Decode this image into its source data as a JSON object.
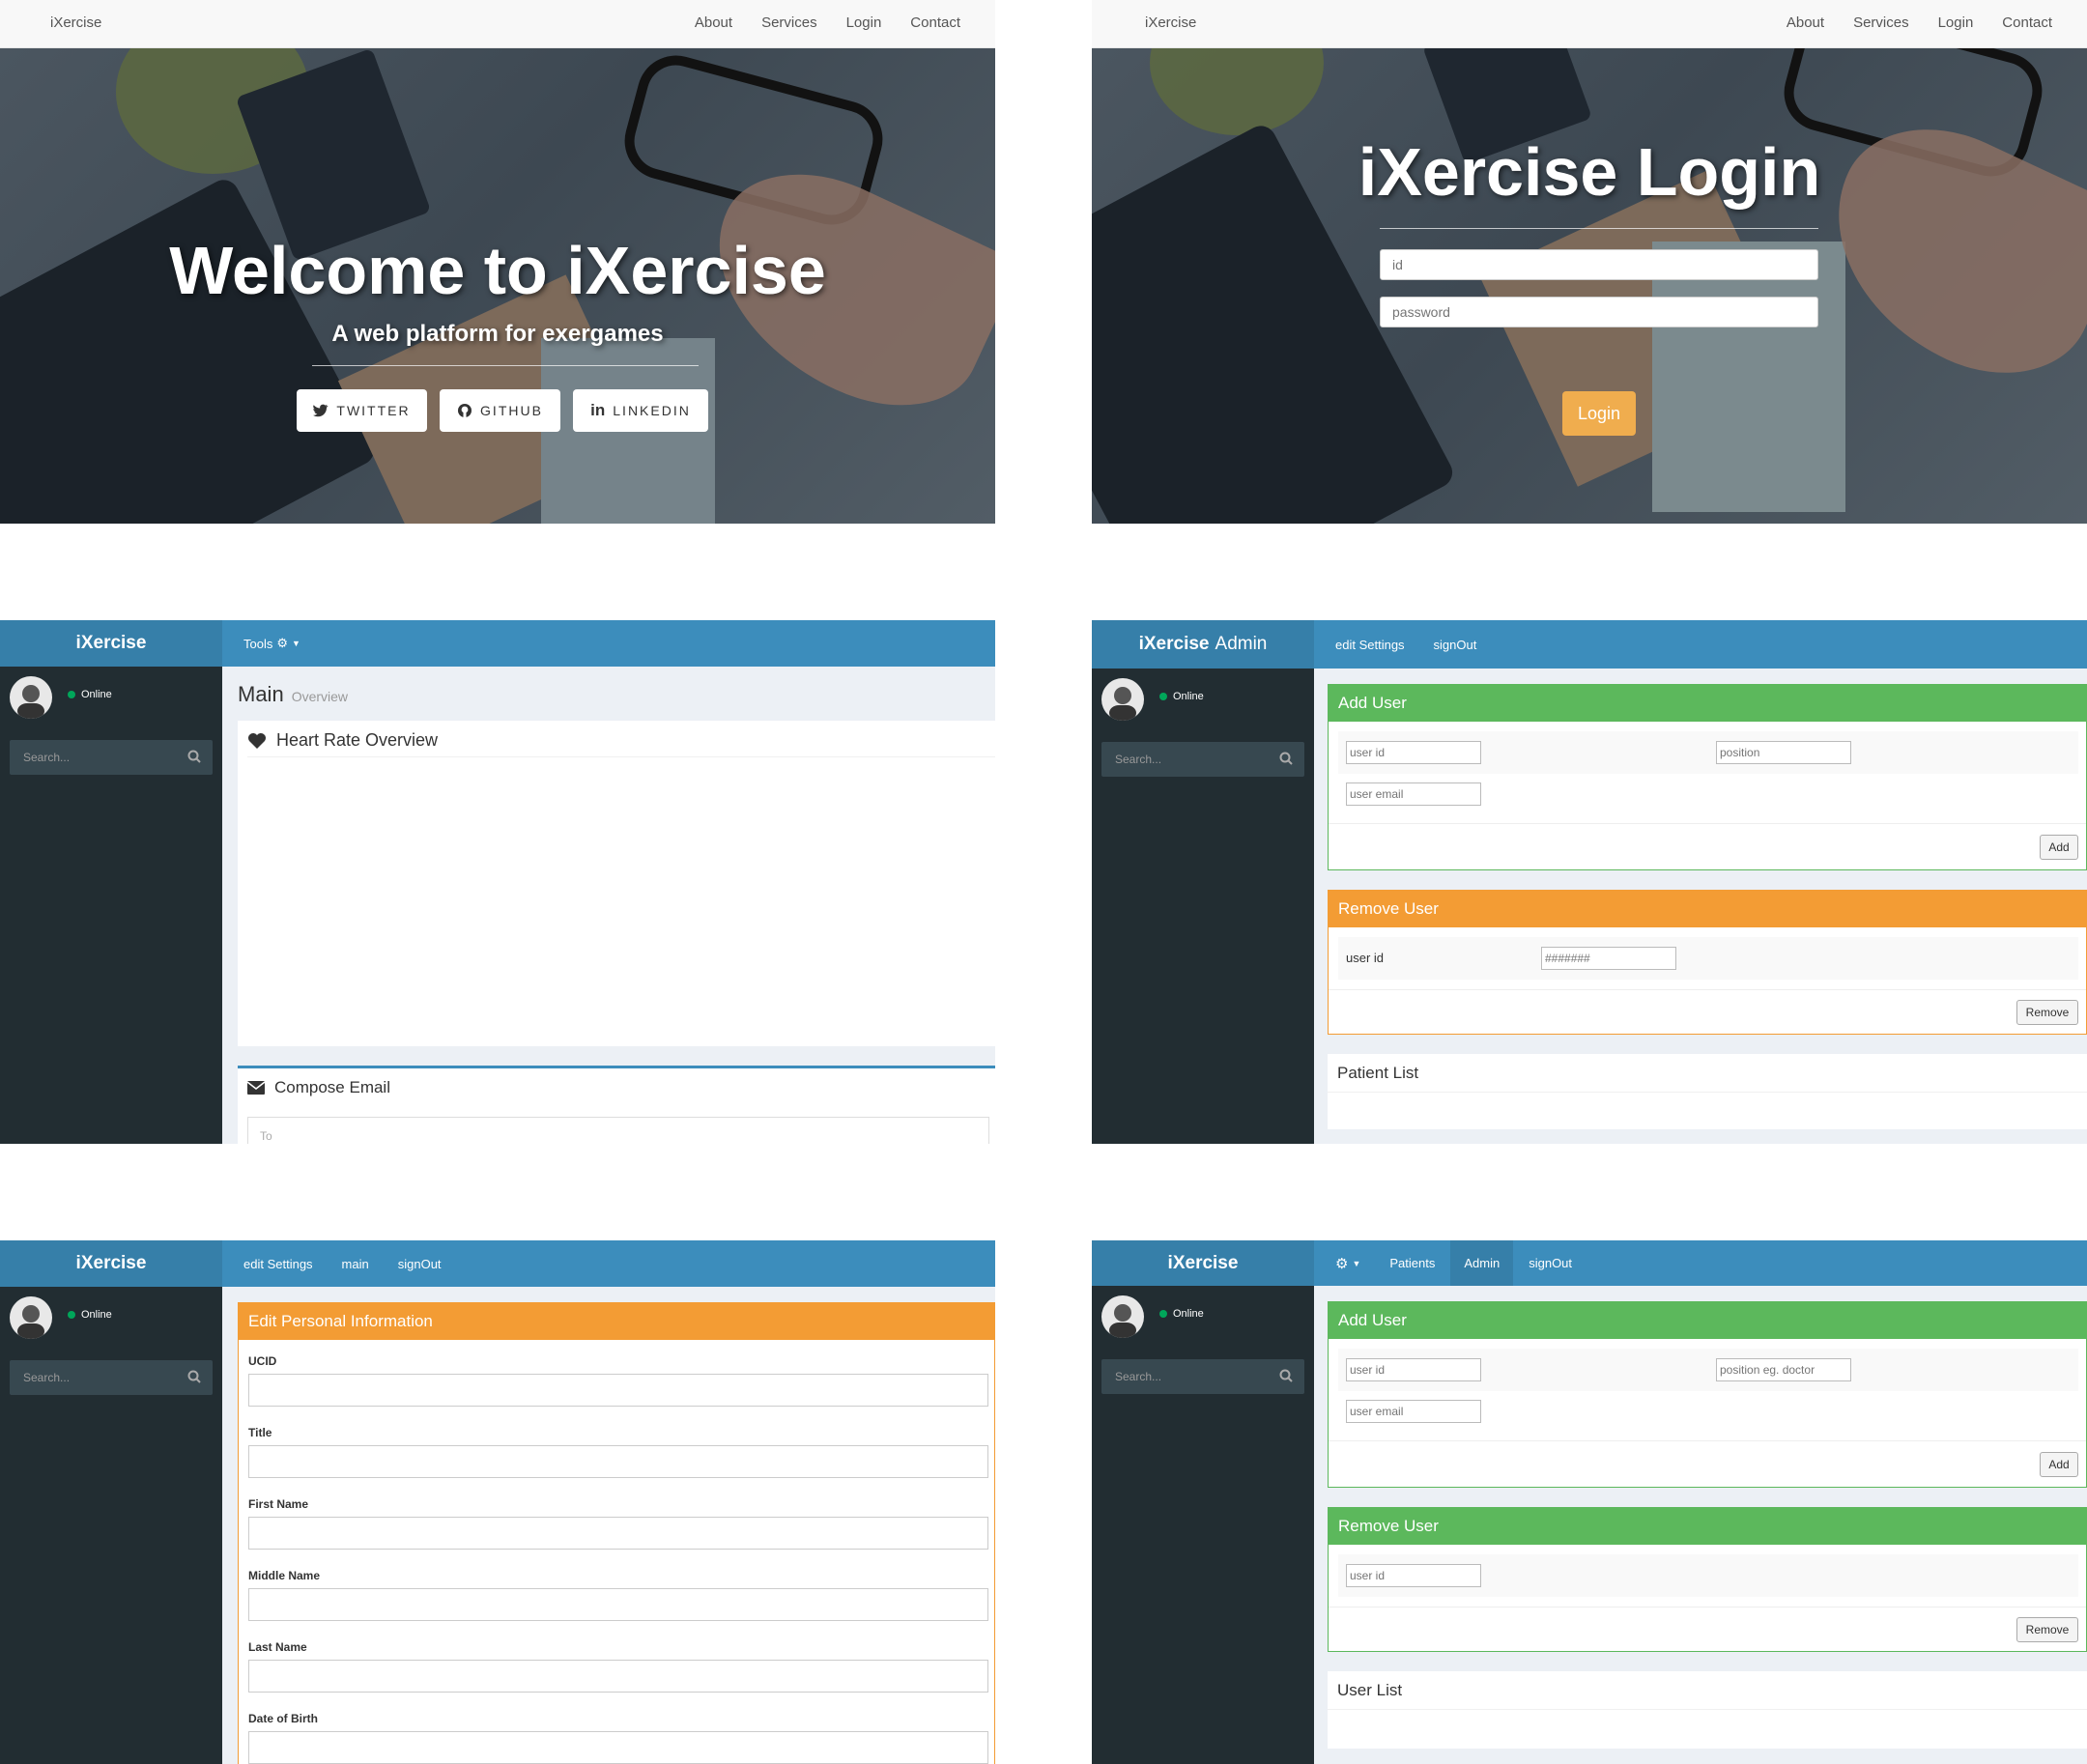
{
  "landing": {
    "brand": "iXercise",
    "nav": [
      "About",
      "Services",
      "Login",
      "Contact"
    ],
    "title": "Welcome to iXercise",
    "subtitle": "A web platform for exergames",
    "buttons": [
      {
        "label": "TWITTER",
        "icon": "twitter-icon"
      },
      {
        "label": "GITHUB",
        "icon": "github-icon"
      },
      {
        "label": "LINKEDIN",
        "icon": "linkedin-icon"
      }
    ]
  },
  "login": {
    "brand": "iXercise",
    "nav": [
      "About",
      "Services",
      "Login",
      "Contact"
    ],
    "title": "iXercise Login",
    "id_placeholder": "id",
    "password_placeholder": "password",
    "login_label": "Login"
  },
  "main": {
    "logo": "iXercise",
    "tools_label": "Tools",
    "online": "Online",
    "search_placeholder": "Search...",
    "page_title": "Main",
    "page_subtitle": "Overview",
    "heart_box_title": "Heart Rate Overview",
    "compose_title": "Compose Email",
    "to_placeholder": "To"
  },
  "admin": {
    "logo_bold": "iXercise",
    "logo_light": "Admin",
    "nav": [
      "edit Settings",
      "signOut"
    ],
    "online": "Online",
    "search_placeholder": "Search...",
    "add_user": {
      "title": "Add User",
      "user_id_placeholder": "user id",
      "position_placeholder": "position",
      "email_placeholder": "user email",
      "add_label": "Add"
    },
    "remove_user": {
      "title": "Remove User",
      "user_id_label": "user id",
      "user_id_placeholder": "#######",
      "remove_label": "Remove"
    },
    "patient_list_title": "Patient List"
  },
  "edit": {
    "logo": "iXercise",
    "nav": [
      "edit Settings",
      "main",
      "signOut"
    ],
    "online": "Online",
    "search_placeholder": "Search...",
    "box_title": "Edit Personal Information",
    "fields": [
      "UCID",
      "Title",
      "First Name",
      "Middle Name",
      "Last Name",
      "Date of Birth"
    ]
  },
  "admin2": {
    "logo": "iXercise",
    "nav": [
      "Patients",
      "Admin",
      "signOut"
    ],
    "online": "Online",
    "search_placeholder": "Search...",
    "add_user": {
      "title": "Add User",
      "user_id_placeholder": "user id",
      "position_placeholder": "position eg. doctor",
      "email_placeholder": "user email",
      "add_label": "Add"
    },
    "remove_user": {
      "title": "Remove User",
      "user_id_placeholder": "user id",
      "remove_label": "Remove"
    },
    "user_list_title": "User List"
  },
  "colors": {
    "header_blue": "#3c8dbc",
    "logo_blue": "#367fa9",
    "sidebar_dark": "#222d32",
    "green": "#5cb85c",
    "orange": "#f39c34",
    "login_orange": "#f0ad4e"
  }
}
